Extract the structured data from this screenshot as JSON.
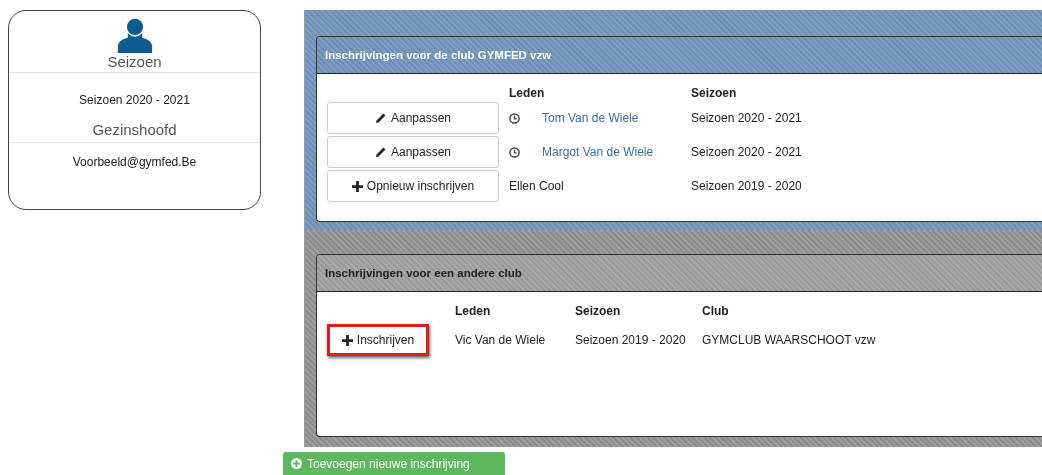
{
  "profile": {
    "title": "Seizoen",
    "season": "Seizoen 2020 - 2021",
    "role": "Gezinshoofd",
    "email": "Voorbeeld@gymfed.Be"
  },
  "club_panel": {
    "title": "Inschrijvingen voor de club GYMFED vzw",
    "columns": [
      "Leden",
      "Seizoen"
    ],
    "rows": [
      {
        "kind": "edit",
        "action": "Aanpassen",
        "member": "Tom Van de Wiele",
        "season": "Seizoen 2020 - 2021"
      },
      {
        "kind": "edit",
        "action": "Aanpassen",
        "member": "Margot Van de Wiele",
        "season": "Seizoen 2020 - 2021"
      },
      {
        "kind": "renew",
        "action": "Opnieuw inschrijven",
        "member": "Ellen Cool",
        "season": "Seizoen 2019 - 2020"
      }
    ]
  },
  "other_panel": {
    "title": "Inschrijvingen voor een andere club",
    "columns": [
      "Leden",
      "Seizoen",
      "Club"
    ],
    "rows": [
      {
        "action": "Inschrijven",
        "highlighted": true,
        "member": "Vic Van de Wiele",
        "season": "Seizoen 2019 - 2020",
        "club": "GYMCLUB WAARSCHOOT vzw"
      }
    ]
  },
  "add_button": "Toevoegen nieuwe inschrijving"
}
